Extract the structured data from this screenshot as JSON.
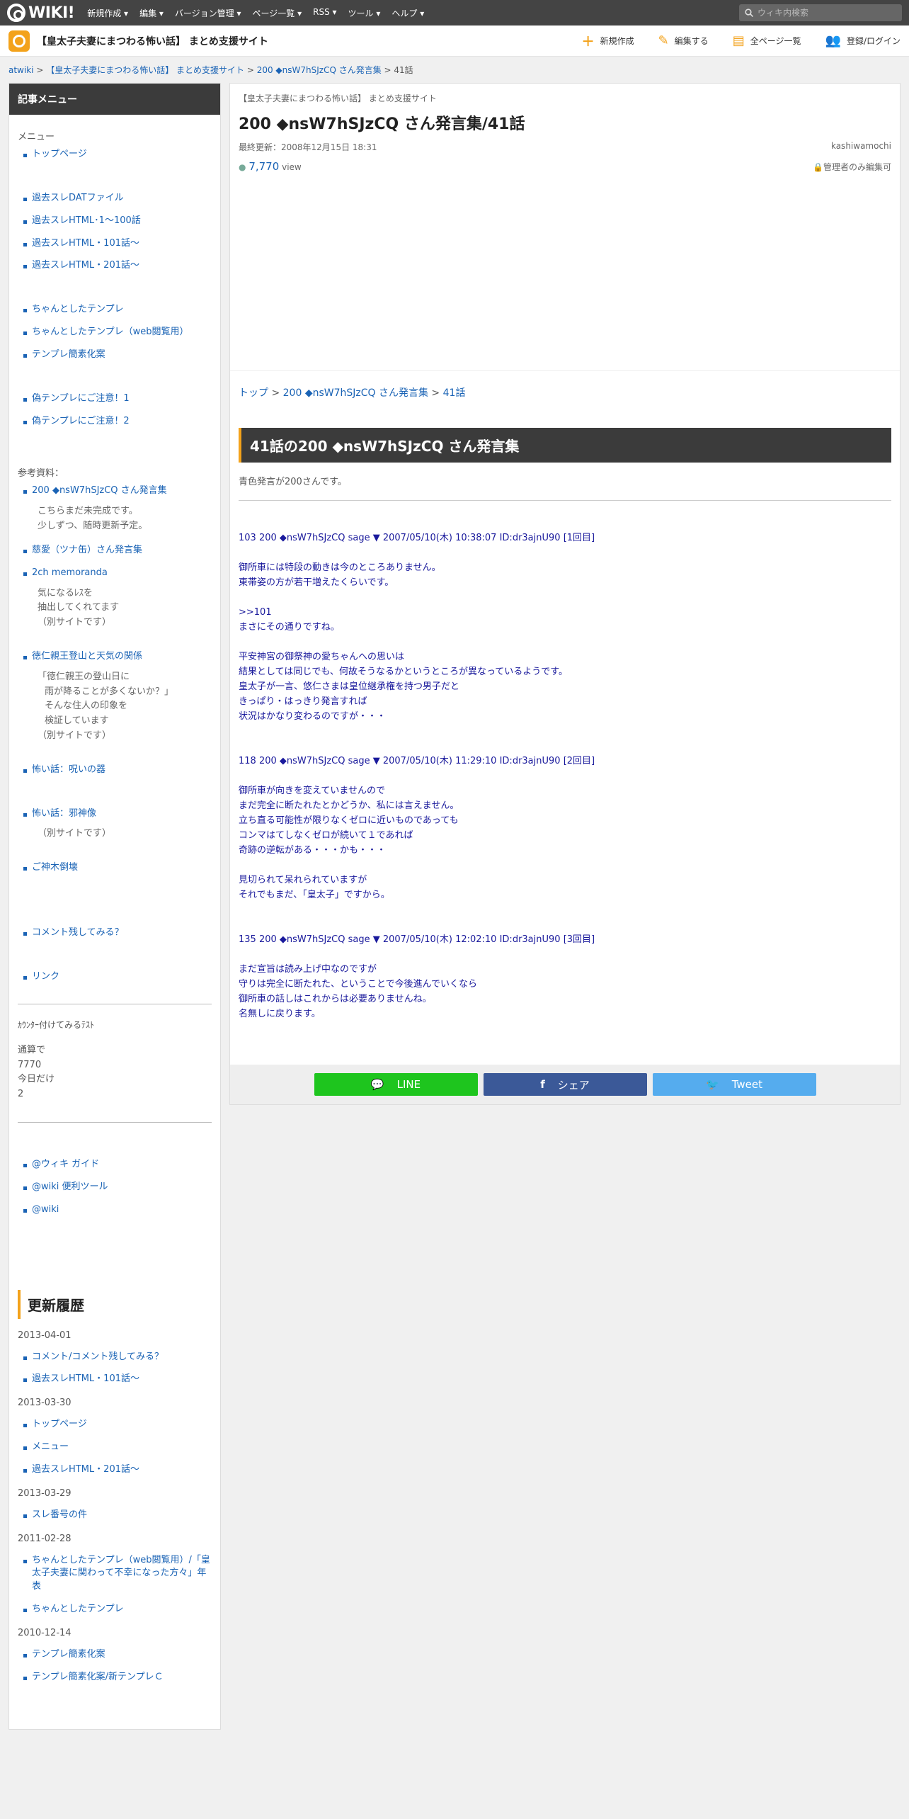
{
  "topbar": {
    "logo": "WIKI!",
    "menu": [
      "新規作成 ▾",
      "編集 ▾",
      "バージョン管理 ▾",
      "ページ一覧 ▾",
      "RSS ▾",
      "ツール ▾",
      "ヘルプ ▾"
    ],
    "search_placeholder": "ウィキ内検索"
  },
  "site": {
    "title": "【皇太子夫妻にまつわる怖い話】 まとめ支援サイト",
    "actions": [
      "新規作成",
      "編集する",
      "全ページ一覧",
      "登録/ログイン"
    ]
  },
  "breadcrumb": [
    "atwiki",
    "【皇太子夫妻にまつわる怖い話】 まとめ支援サイト",
    "200 ◆nsW7hSJzCQ さん発言集",
    "41話"
  ],
  "sidebar": {
    "heading": "記事メニュー",
    "menu_label": "メニュー",
    "group1": [
      "トップページ"
    ],
    "group2": [
      "過去スレDATファイル",
      "過去スレHTML･1～100話",
      "過去スレHTML・101話～",
      "過去スレHTML・201話～"
    ],
    "group3": [
      "ちゃんとしたテンプレ",
      "ちゃんとしたテンプレ（web閲覧用）",
      "テンプレ簡素化案"
    ],
    "group4": [
      "偽テンプレにご注意！1",
      "偽テンプレにご注意！2"
    ],
    "ref_label": "参考資料：",
    "ref1": "200 ◆nsW7hSJzCQ さん発言集",
    "ref1_note1": "こちらまだ未完成です。",
    "ref1_note2": "少しずつ、随時更新予定。",
    "ref2": "慈愛（ツナ缶）さん発言集",
    "ref3": "2ch memoranda",
    "ref3_note1": "気になるﾚｽを",
    "ref3_note2": "抽出してくれてます",
    "ref3_note3": "（別サイトです）",
    "ref4": "徳仁親王登山と天気の関係",
    "ref4_note1": "「徳仁親王の登山日に",
    "ref4_note2": "雨が降ることが多くないか？」",
    "ref4_note3": "そんな住人の印象を",
    "ref4_note4": "検証しています",
    "ref4_note5": "（別サイトです）",
    "scary1": "怖い話：呪いの器",
    "scary2": "怖い話：邪神像",
    "scary2_note": "（別サイトです）",
    "shinboku": "ご神木倒壊",
    "comment": "コメント残してみる？",
    "link": "リンク",
    "counter_title": "ｶｳﾝﾀｰ付けてみるﾃｽﾄ",
    "counter_total_label": "通算で",
    "counter_total": "7770",
    "counter_today_label": "今日だけ",
    "counter_today": "2",
    "guides": [
      "@ウィキ ガイド",
      "@wiki 便利ツール",
      "@wiki"
    ],
    "history_title": "更新履歴",
    "history": [
      {
        "date": "2013-04-01",
        "items": [
          "コメント/コメント残してみる？",
          "過去スレHTML・101話～"
        ]
      },
      {
        "date": "2013-03-30",
        "items": [
          "トップページ",
          "メニュー",
          "過去スレHTML・201話～"
        ]
      },
      {
        "date": "2013-03-29",
        "items": [
          "スレ番号の件"
        ]
      },
      {
        "date": "2011-02-28",
        "items": [
          "ちゃんとしたテンプレ（web閲覧用）/「皇太子夫妻に関わって不幸になった方々」年表",
          "ちゃんとしたテンプレ"
        ]
      },
      {
        "date": "2010-12-14",
        "items": [
          "テンプレ簡素化案",
          "テンプレ簡素化案/新テンプレＣ"
        ]
      }
    ]
  },
  "main": {
    "site_name": "【皇太子夫妻にまつわる怖い話】 まとめ支援サイト",
    "title": "200 ◆nsW7hSJzCQ さん発言集/41話",
    "last_updated": "最終更新：2008年12月15日 18:31",
    "author": "kashiwamochi",
    "views": "7,770",
    "views_unit": "view",
    "edit_perm": "管理者のみ編集可",
    "crumbs": [
      "トップ",
      "200 ◆nsW7hSJzCQ さん発言集",
      "41話"
    ],
    "section_title": "41話の200 ◆nsW7hSJzCQ さん発言集",
    "section_sub": "青色発言が200さんです。",
    "posts": [
      {
        "head": "103 200 ◆nsW7hSJzCQ sage ▼ 2007/05/10(木) 10:38:07 ID:dr3ajnU90 [1回目]",
        "p1": "御所車には特段の動きは今のところありません。\n東帯姿の方が若干増えたくらいです。",
        "p2": ">>101\nまさにその通りですね。",
        "p3": "平安神宮の御祭神の愛ちゃんへの思いは\n結果としては同じでも、何故そうなるかというところが異なっているようです。\n皇太子が一言、悠仁さまは皇位継承権を持つ男子だと\nきっぱり・はっきり発言すれば\n状況はかなり変わるのですが・・・"
      },
      {
        "head": "118 200 ◆nsW7hSJzCQ sage ▼ 2007/05/10(木) 11:29:10 ID:dr3ajnU90 [2回目]",
        "p1": "御所車が向きを変えていませんので\nまだ完全に断たれたとかどうか、私には言えません。\n立ち直る可能性が限りなくゼロに近いものであっても\nコンマはてしなくゼロが続いて１であれば\n奇跡の逆転がある・・・かも・・・",
        "p2": "見切られて呆れられていますが\nそれでもまだ、「皇太子」ですから。"
      },
      {
        "head": "135 200 ◆nsW7hSJzCQ sage ▼ 2007/05/10(木) 12:02:10 ID:dr3ajnU90 [3回目]",
        "p1": "まだ宣旨は読み上げ中なのですが\n守りは完全に断たれた、ということで今後進んでいくなら\n御所車の話しはこれからは必要ありませんね。\n名無しに戻ります。"
      }
    ],
    "share": {
      "line": "LINE",
      "facebook": "シェア",
      "twitter": "Tweet"
    }
  }
}
